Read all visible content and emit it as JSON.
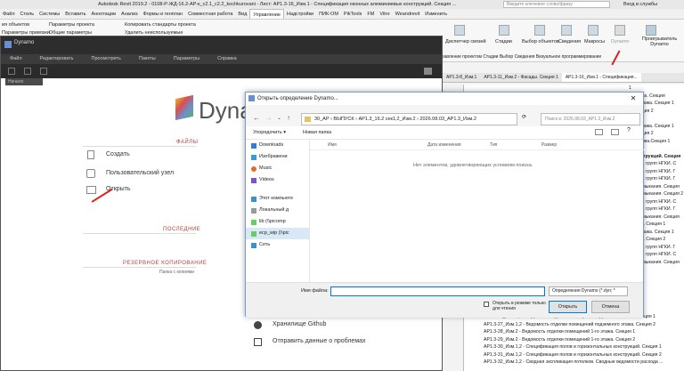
{
  "revit": {
    "title": "Autodesk Revit 2019.2 - 0108-Р-ЖД-16.2-АР-к_с2.1_с2.2_kochkurovani - Лист: АР1.3-16_Изм.1 - Спецификация оконных алюминиевых конструкций. Секция ...",
    "search_placeholder": "Введите ключевое слово/фразу",
    "sign_in": "Вход в службы",
    "tabs": [
      "Файл",
      "Стиль",
      "Системы",
      "Вставить",
      "Аннотации",
      "Анализ",
      "Формы и генплан",
      "Совместная работа",
      "Вид",
      "Управление",
      "Надстройки",
      "ПИК-ОМ",
      "PikTools",
      "FM",
      "Vitro",
      "Weandrevit",
      "Изменить"
    ],
    "active_tab": "Управление",
    "ribbon_left": [
      "ия объектов",
      "Параметры проекта",
      "Копировать стандарты проекта",
      "Общие параметры",
      "Удалить неиспользуемые",
      "Параметры привязки"
    ],
    "ribbon_right": [
      "Диспетчер связей",
      "Стадии",
      "Выбор объектов",
      "Сведения",
      "Макросы",
      "Dynamo",
      "Проигрыватель Dynamo"
    ],
    "ribbon_bottom": "Управление проектом   Стадии   Выбор   Сведения   Визуальное программирование",
    "sheet_tabs": [
      "АР1.3-8_Изм.1",
      "АР1.3-11_Изм.2 - Фасады. Секция 1",
      "АР1.3-16_Изм.1 - Спецификация..."
    ]
  },
  "dynamo": {
    "app_title": "Dynamo",
    "menu": [
      "Файл",
      "Редактировать",
      "Просмотреть",
      "Пакеты",
      "Параметры",
      "Справка"
    ],
    "start_tab": "Начало",
    "logo": "Dyna",
    "files_label": "ФАЙЛЫ",
    "create": "Создать",
    "custom_node": "Пользовательский узел",
    "open": "Открыть",
    "recent_label": "ПОСЛЕДНИЕ",
    "backup_label": "РЕЗЕРВНОЕ КОПИРОВАНИЕ",
    "backup_folder": "Папка с копиями",
    "github": "Хранилище Github",
    "report_issue": "Отправить данные о проблемах"
  },
  "dialog": {
    "title": "Открыть определение Dynamo...",
    "path": [
      "30_АР",
      "ВЫПУСК",
      "АР1.3_16.2 сек1,2_Изм.2",
      "2026.08.03_АР1.3_Изм.2"
    ],
    "search_placeholder": "Поиск в: 2026.08.03_АР1.3_Изм.2",
    "organize": "Упорядочить ▾",
    "new_folder": "Новая папка",
    "columns": [
      "Имя",
      "Дата изменения",
      "Тип",
      "Размер"
    ],
    "empty_message": "Нет элементов, удовлетворяющих условиям поиска.",
    "sidebar": [
      "Downloads",
      "Изображени",
      "Music",
      "Videos",
      "Этот компьюте",
      "Локальный д",
      "lib (\\\\picomp",
      "ecp_wip (\\\\pic",
      "Сеть"
    ],
    "filename_label": "Имя файла:",
    "filter": "Определения Dynamo (*.dyn; *",
    "readonly_label": "Открыть в режиме только для чтения",
    "open_button": "Открыть",
    "cancel_button": "Отмена"
  },
  "right_panel": {
    "lines": [
      "",
      "1",
      "го этажа. Секция",
      "ного этажа. Секция 1",
      "а. Секция 2",
      "2",
      "ного этажа. Секция 1",
      "а. Секция 2",
      "ого этажа.Секция 1",
      "",
      "х конструкций. Секция",
      "ходных групп НГКИ. С",
      "ходных групп НГКИ. Г",
      "ходных групп НГКИ. Г",
      "ак примыкания. Секция",
      "ак примыкания. Секция 2",
      "ходных групп НГКИ. С",
      "ходных групп НГКИ. Г",
      "ак примыкания. Секция",
      "рукций. Секция 1",
      "ного этажа. Секция 1",
      "рукций. Секция 2",
      "ходных групп НГКИ. Г",
      "ходных групп НГКИ. С",
      "ак примыкания. Секция"
    ],
    "sheet_rows": [
      "АР1.3-26_Изм.1,2 - Ведомость отделки помещений подземного этажа. Секция 1",
      "АР1.3-27_Изм.1,2 - Ведомость отделки помещений подземного этажа. Секция 2",
      "АР1.3-28_Изм.2 - Ведомость отделки помещений 1-го этажа. Секция 1",
      "АР1.3-29_Изм.2 - Ведомость отделки помещений 1-го этажа. Секция 2",
      "АР1.3-30_Изм.1,2 - Спецификация полов и горизонтальных конструкций. Секция 1",
      "АР1.3-31_Изм.1,2 - Спецификация полов и горизонтальных конструкций. Секция 2",
      "АР1.3-32_Изм.1,2 - Сводная экспликация потолков. Сводные ведомости расхода ..."
    ]
  }
}
